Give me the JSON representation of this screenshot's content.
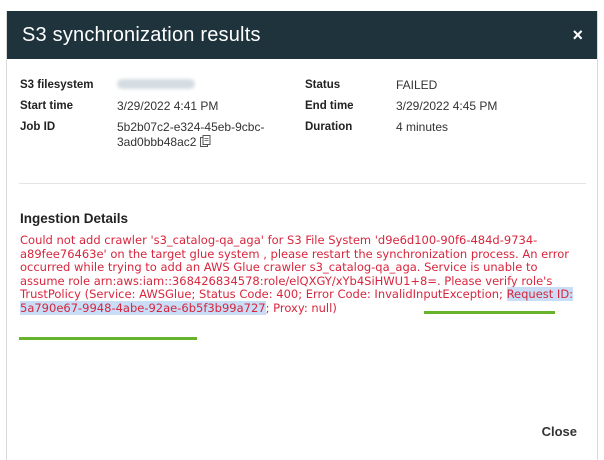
{
  "dialog": {
    "title": "S3 synchronization results",
    "close_icon": "×",
    "close_button_label": "Close"
  },
  "info": {
    "s3_filesystem": {
      "label": "S3 filesystem",
      "value": ""
    },
    "start_time": {
      "label": "Start time",
      "value": "3/29/2022 4:41 PM"
    },
    "job_id": {
      "label": "Job ID",
      "value_line1": "5b2b07c2-e324-45eb-9cbc-",
      "value_line2": "3ad0bbb48ac2"
    },
    "status": {
      "label": "Status",
      "value": "FAILED"
    },
    "end_time": {
      "label": "End time",
      "value": "3/29/2022 4:45 PM"
    },
    "duration": {
      "label": "Duration",
      "value": "4 minutes"
    }
  },
  "ingestion": {
    "title": "Ingestion Details",
    "error_pre": "Could not add crawler 's3_catalog-qa_aga' for S3 File System 'd9e6d100-90f6-484d-9734-a89fee76463e' on the target glue system , please restart the synchronization process. An error occurred while trying to add an AWS Glue crawler s3_catalog-qa_aga. Service is unable to assume role arn:aws:iam::368426834578:role/elQXGY/xYb4SiHWU1+8=. Please verify role's TrustPolicy (Service: AWSGlue; Status Code: 400; Error Code: InvalidInputException; ",
    "error_highlight": "Request ID: 5a790e67-9948-4abe-92ae-6b5f3b99a727",
    "error_post": "; Proxy: null)"
  },
  "colors": {
    "header_bg": "#1f333d",
    "error_text": "#d7263d",
    "highlight": "#c9ddf7",
    "underline": "#67b32e"
  }
}
